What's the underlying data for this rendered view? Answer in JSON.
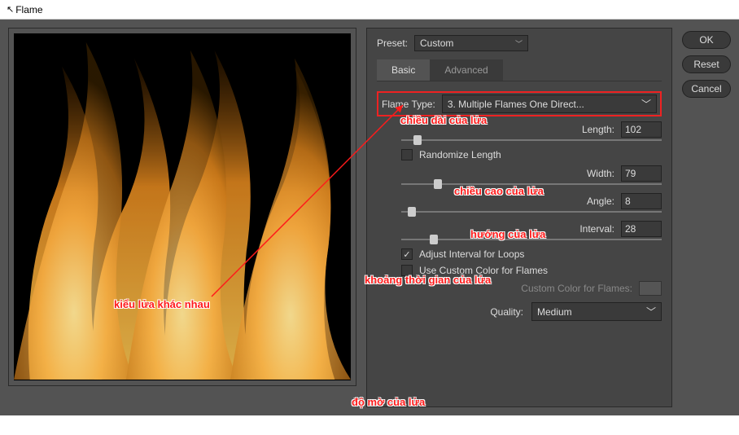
{
  "window": {
    "title": "Flame"
  },
  "preset": {
    "label": "Preset:",
    "value": "Custom"
  },
  "tabs": {
    "basic": "Basic",
    "advanced": "Advanced"
  },
  "flame_type": {
    "label": "Flame Type:",
    "value": "3. Multiple Flames One Direct..."
  },
  "length": {
    "label": "Length:",
    "value": "102"
  },
  "randomize": {
    "label": "Randomize Length"
  },
  "width": {
    "label": "Width:",
    "value": "79"
  },
  "angle": {
    "label": "Angle:",
    "value": "8"
  },
  "interval": {
    "label": "Interval:",
    "value": "28"
  },
  "adjust_loops": {
    "label": "Adjust Interval for Loops"
  },
  "custom_color": {
    "label": "Use Custom Color for Flames"
  },
  "custom_color_swatch": {
    "label": "Custom Color for Flames:"
  },
  "quality": {
    "label": "Quality:",
    "value": "Medium"
  },
  "buttons": {
    "ok": "OK",
    "reset": "Reset",
    "cancel": "Cancel"
  },
  "annotations": {
    "kieu": "kiểu lửa khác nhau",
    "chieu_dai": "chiều dài của lửa",
    "chieu_cao": "chiều cao của lửa",
    "huong": "hướng của lửa",
    "khoang": "khoảng thời gian của lửa",
    "do_mo": "độ mờ của lửa"
  }
}
